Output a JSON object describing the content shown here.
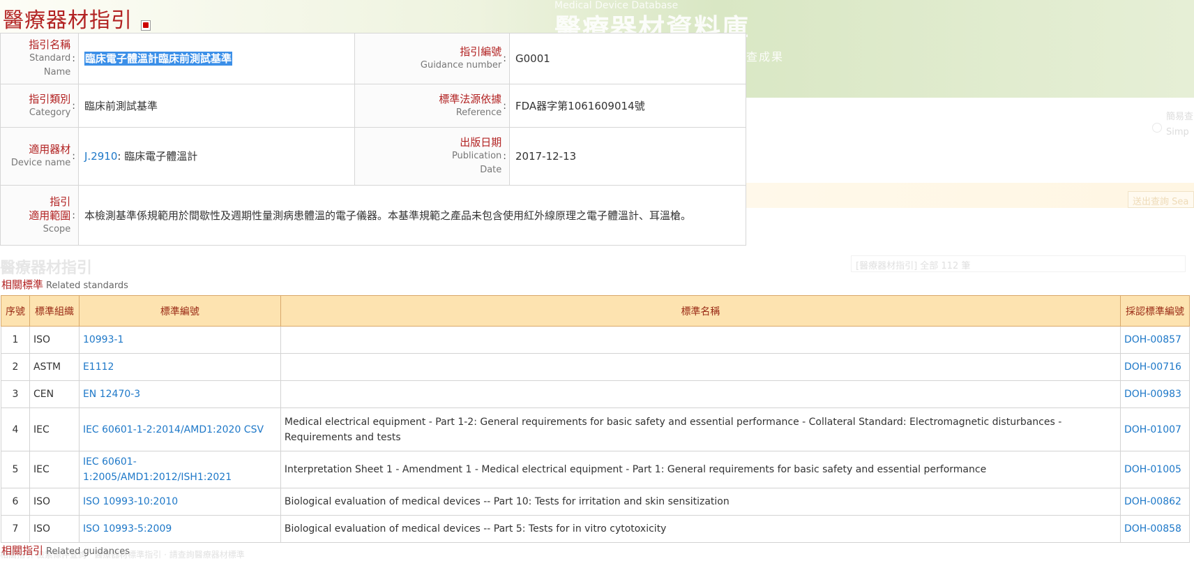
{
  "background": {
    "site_subtitle": "Medical Device Database",
    "site_logo": "醫療器材資料庫",
    "slogan": "查成果",
    "section_title": "醫療器材指引",
    "count_text": "[醫療器材指引] 全部 112 筆",
    "search_button": "送出查詢 Sea",
    "radio_label_zh": "簡易查",
    "radio_label_en": "Simp",
    "footnote": "相關指引 檢索條件查詢 · 醫療器材標準指引 · 請查詢醫療器材標準"
  },
  "page": {
    "title": "醫療器材指引"
  },
  "info": {
    "standard_name": {
      "zh": "指引名稱",
      "en": "Standard Name",
      "value": "臨床電子體溫計臨床前測試基準"
    },
    "guidance_number": {
      "zh": "指引編號",
      "en": "Guidance number",
      "value": "G0001"
    },
    "category": {
      "zh": "指引類別",
      "en": "Category",
      "value": "臨床前測試基準"
    },
    "reference": {
      "zh": "標準法源依據",
      "en": "Reference",
      "value": "FDA器字第1061609014號"
    },
    "device_name": {
      "zh": "適用器材",
      "en": "Device name",
      "code": "J.2910",
      "value": "臨床電子體溫計"
    },
    "publication_date": {
      "zh": "出版日期",
      "en1": "Publication",
      "en2": "Date",
      "value": "2017-12-13"
    },
    "scope": {
      "zh1": "指引",
      "zh2": "適用範圍",
      "en": "Scope",
      "value": "本檢測基準係規範用於間歇性及週期性量測病患體溫的電子儀器。本基準規範之產品未包含使用紅外線原理之電子體溫計、耳溫槍。"
    }
  },
  "related_standards": {
    "label_zh": "相關標準",
    "label_en": "Related standards",
    "headers": [
      "序號",
      "標準組織",
      "標準編號",
      "標準名稱",
      "採認標準編號"
    ],
    "rows": [
      {
        "no": "1",
        "org": "ISO",
        "code": "10993-1",
        "name": "",
        "doh": "DOH-00857"
      },
      {
        "no": "2",
        "org": "ASTM",
        "code": "E1112",
        "name": "",
        "doh": "DOH-00716"
      },
      {
        "no": "3",
        "org": "CEN",
        "code": "EN 12470-3",
        "name": "",
        "doh": "DOH-00983"
      },
      {
        "no": "4",
        "org": "IEC",
        "code": "IEC 60601-1-2:2014/AMD1:2020 CSV",
        "name": "Medical electrical equipment - Part 1-2: General requirements for basic safety and essential performance - Collateral Standard: Electromagnetic disturbances - Requirements and tests",
        "doh": "DOH-01007"
      },
      {
        "no": "5",
        "org": "IEC",
        "code": "IEC 60601-1:2005/AMD1:2012/ISH1:2021",
        "name": "Interpretation Sheet 1 - Amendment 1 - Medical electrical equipment - Part 1: General requirements for basic safety and essential performance",
        "doh": "DOH-01005"
      },
      {
        "no": "6",
        "org": "ISO",
        "code": "ISO 10993-10:2010",
        "name": "Biological evaluation of medical devices -- Part 10: Tests for irritation and skin sensitization",
        "doh": "DOH-00862"
      },
      {
        "no": "7",
        "org": "ISO",
        "code": "ISO 10993-5:2009",
        "name": "Biological evaluation of medical devices -- Part 5: Tests for in vitro cytotoxicity",
        "doh": "DOH-00858"
      }
    ]
  },
  "related_guidances": {
    "label_zh": "相關指引",
    "label_en": "Related guidances"
  }
}
